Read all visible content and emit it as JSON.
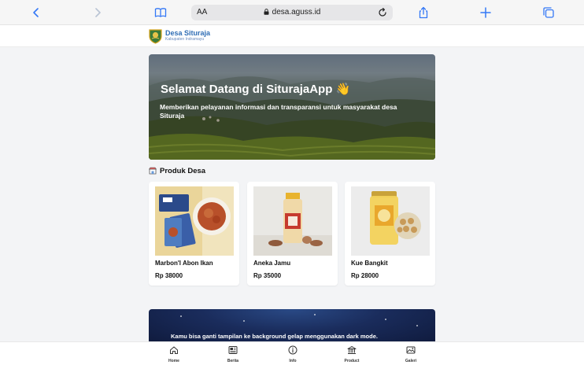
{
  "browser": {
    "text_size_label": "AA",
    "url": "desa.aguss.id"
  },
  "site": {
    "name": "Desa Situraja",
    "subtitle": "Kabupaten Indramayu"
  },
  "hero": {
    "title": "Selamat Datang di SiturajaApp 👋",
    "description": "Memberikan pelayanan informasi dan transparansi untuk masyarakat desa Situraja"
  },
  "products_section": {
    "title": "Produk Desa",
    "items": [
      {
        "name": "Marbon'l Abon Ikan",
        "price": "Rp 38000"
      },
      {
        "name": "Aneka Jamu",
        "price": "Rp 35000"
      },
      {
        "name": "Kue Bangkit",
        "price": "Rp 28000"
      }
    ]
  },
  "dark_banner": {
    "text": "Kamu bisa ganti tampilan ke background gelap menggunakan dark mode."
  },
  "bottom_nav": {
    "items": [
      {
        "label": "Home",
        "icon": "home-icon"
      },
      {
        "label": "Berita",
        "icon": "news-icon"
      },
      {
        "label": "Info",
        "icon": "info-icon"
      },
      {
        "label": "Product",
        "icon": "product-icon"
      },
      {
        "label": "Galeri",
        "icon": "gallery-icon"
      }
    ]
  },
  "colors": {
    "accent": "#2f6db5",
    "browser_icon": "#3478f6",
    "page_bg": "#f3f4f6"
  }
}
